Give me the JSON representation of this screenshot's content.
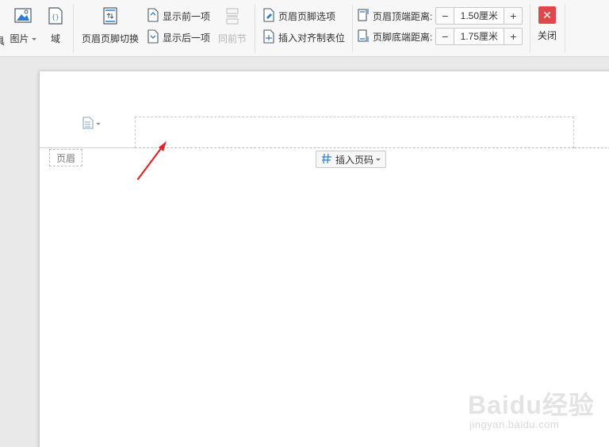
{
  "ribbon": {
    "partial_left_label": "具",
    "picture_label": "图片",
    "field_label": "域",
    "header_footer_switch_label": "页眉页脚切换",
    "show_prev_label": "显示前一项",
    "show_next_label": "显示后一项",
    "same_as_prev_label": "同前节",
    "header_footer_options_label": "页眉页脚选项",
    "insert_align_tab_label": "插入对齐制表位",
    "header_top_distance": {
      "label": "页眉顶端距离:",
      "value": "1.50厘米",
      "minus": "−",
      "plus": "+"
    },
    "footer_bottom_distance": {
      "label": "页脚底端距离:",
      "value": "1.75厘米",
      "minus": "−",
      "plus": "+"
    },
    "close_label": "关闭",
    "close_glyph": "✕"
  },
  "document": {
    "header_tag": "页眉",
    "insert_page_number_label": "插入页码"
  },
  "colors": {
    "accent_blue": "#2b7cd3",
    "close_red": "#e0474c",
    "annotation_arrow": "#e0242a"
  },
  "watermark": {
    "brand": "Baidu经验",
    "url": "jingyan.baidu.com"
  }
}
